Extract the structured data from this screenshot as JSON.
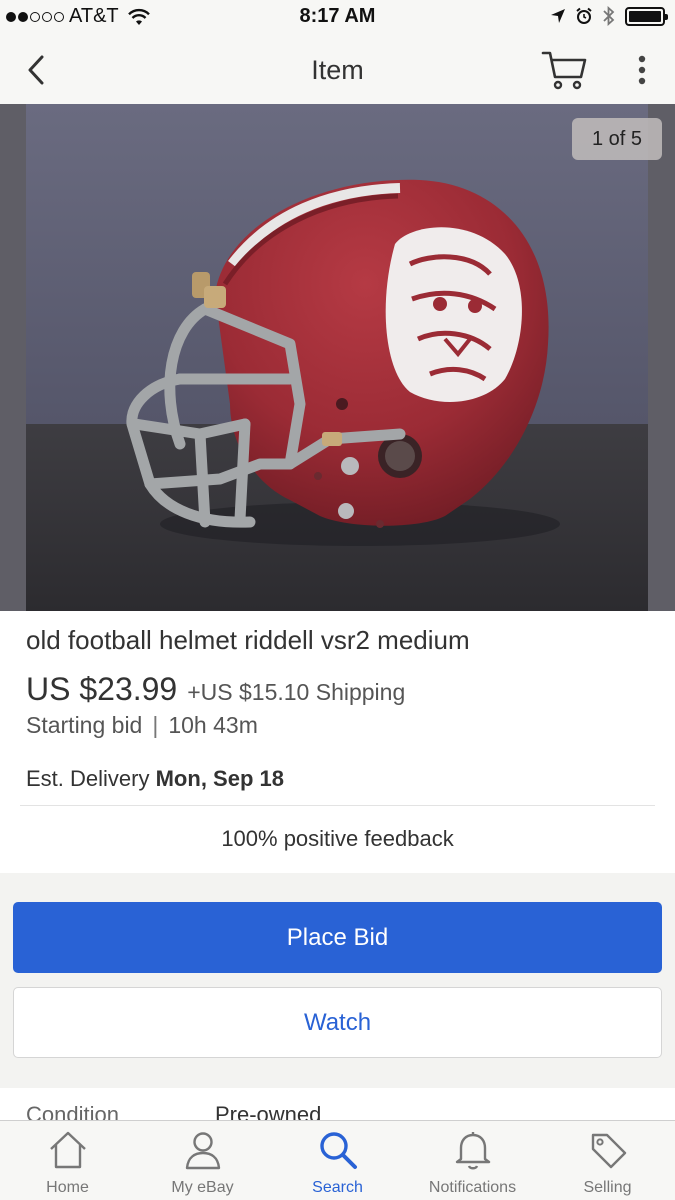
{
  "status_bar": {
    "carrier": "AT&T",
    "time": "8:17 AM",
    "signal_bars": 2,
    "signal_total": 5,
    "battery_level": 1.0
  },
  "nav": {
    "title": "Item",
    "icons": [
      "back-chevron-icon",
      "cart-icon",
      "more-vertical-icon"
    ]
  },
  "photo": {
    "counter": "1 of 5",
    "subject": "maroon football helmet with tiger decal"
  },
  "item": {
    "title": "old football helmet riddell vsr2 medium",
    "price": "US $23.99",
    "shipping": "+US $15.10 Shipping",
    "bid_type": "Starting bid",
    "separator": "|",
    "time_left": "10h 43m",
    "delivery_label": "Est. Delivery",
    "delivery_date": "Mon, Sep 18",
    "feedback": "100% positive feedback"
  },
  "actions": {
    "place_bid": "Place Bid",
    "watch": "Watch"
  },
  "details": {
    "condition_label": "Condition",
    "condition_value": "Pre-owned"
  },
  "tabs": [
    {
      "label": "Home",
      "icon": "home-icon",
      "active": false
    },
    {
      "label": "My eBay",
      "icon": "user-icon",
      "active": false
    },
    {
      "label": "Search",
      "icon": "search-icon",
      "active": true
    },
    {
      "label": "Notifications",
      "icon": "bell-icon",
      "active": false
    },
    {
      "label": "Selling",
      "icon": "tag-icon",
      "active": false
    }
  ],
  "colors": {
    "accent": "#2962d5",
    "helmet": "#9b2b35",
    "bar_background": "#f7f7f5"
  }
}
